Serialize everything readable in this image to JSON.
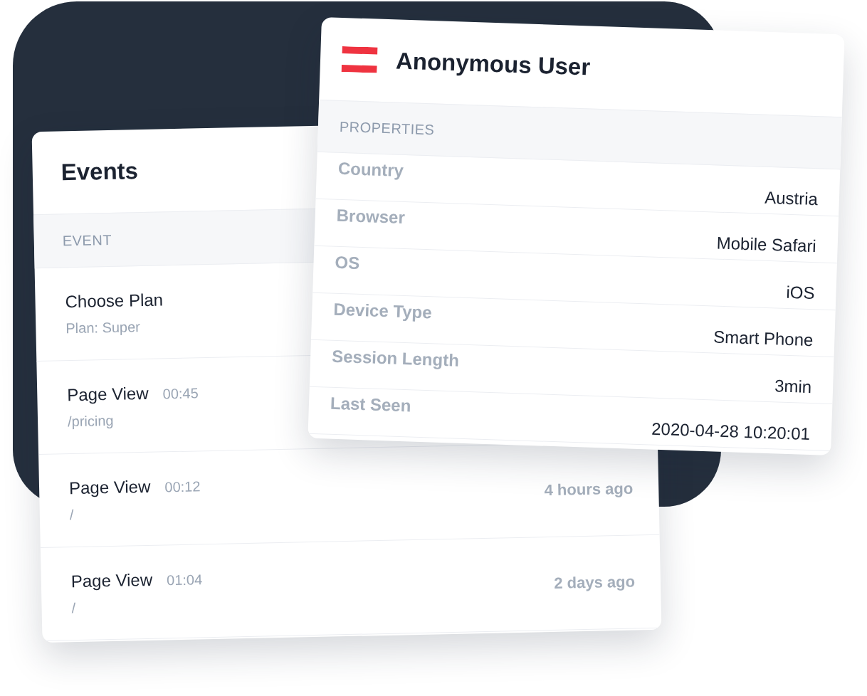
{
  "events_card": {
    "title": "Events",
    "column_header": "EVENT",
    "rows": [
      {
        "name": "Choose Plan",
        "time": "",
        "detail": "Plan: Super",
        "ago": ""
      },
      {
        "name": "Page View",
        "time": "00:45",
        "detail": "/pricing",
        "ago": ""
      },
      {
        "name": "Page View",
        "time": "00:12",
        "detail": "/",
        "ago": "4 hours ago"
      },
      {
        "name": "Page View",
        "time": "01:04",
        "detail": "/",
        "ago": "2 days ago"
      }
    ]
  },
  "user_card": {
    "title": "Anonymous User",
    "section_header": "PROPERTIES",
    "properties": [
      {
        "label": "Country",
        "value": "Austria"
      },
      {
        "label": "Browser",
        "value": "Mobile Safari"
      },
      {
        "label": "OS",
        "value": "iOS"
      },
      {
        "label": "Device Type",
        "value": "Smart Phone"
      },
      {
        "label": "Session Length",
        "value": "3min"
      },
      {
        "label": "Last Seen",
        "value": "2020-04-28 10:20:01"
      }
    ]
  }
}
